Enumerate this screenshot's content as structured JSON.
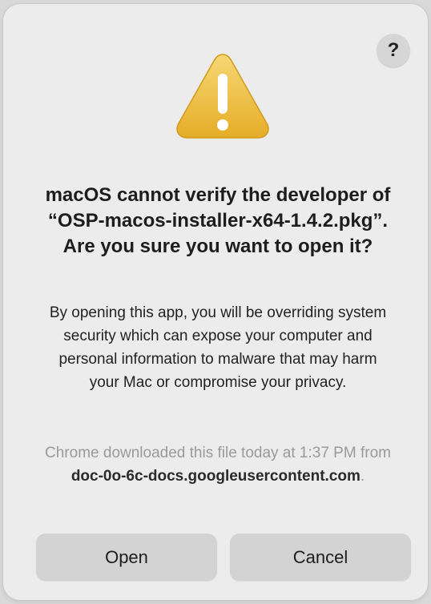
{
  "dialog": {
    "help_label": "?",
    "warning_icon": "warning-triangle-icon",
    "title": "macOS cannot verify the developer of “OSP-macos-installer-x64-1.4.2.pkg”. Are you sure you want to open it?",
    "message": "By opening this app, you will be overriding system security which can expose your computer and personal information to malware that may harm your Mac or compromise your privacy.",
    "source_prefix": "Chrome downloaded this file today at 1:37 PM from ",
    "source_domain": "doc-0o-6c-docs.googleusercontent.com",
    "source_suffix": ".",
    "open_label": "Open",
    "cancel_label": "Cancel"
  },
  "colors": {
    "dialog_bg": "#ececec",
    "button_bg": "#d3d3d3",
    "warning_yellow": "#f2c94c",
    "secondary_text": "#9a9a9a"
  }
}
